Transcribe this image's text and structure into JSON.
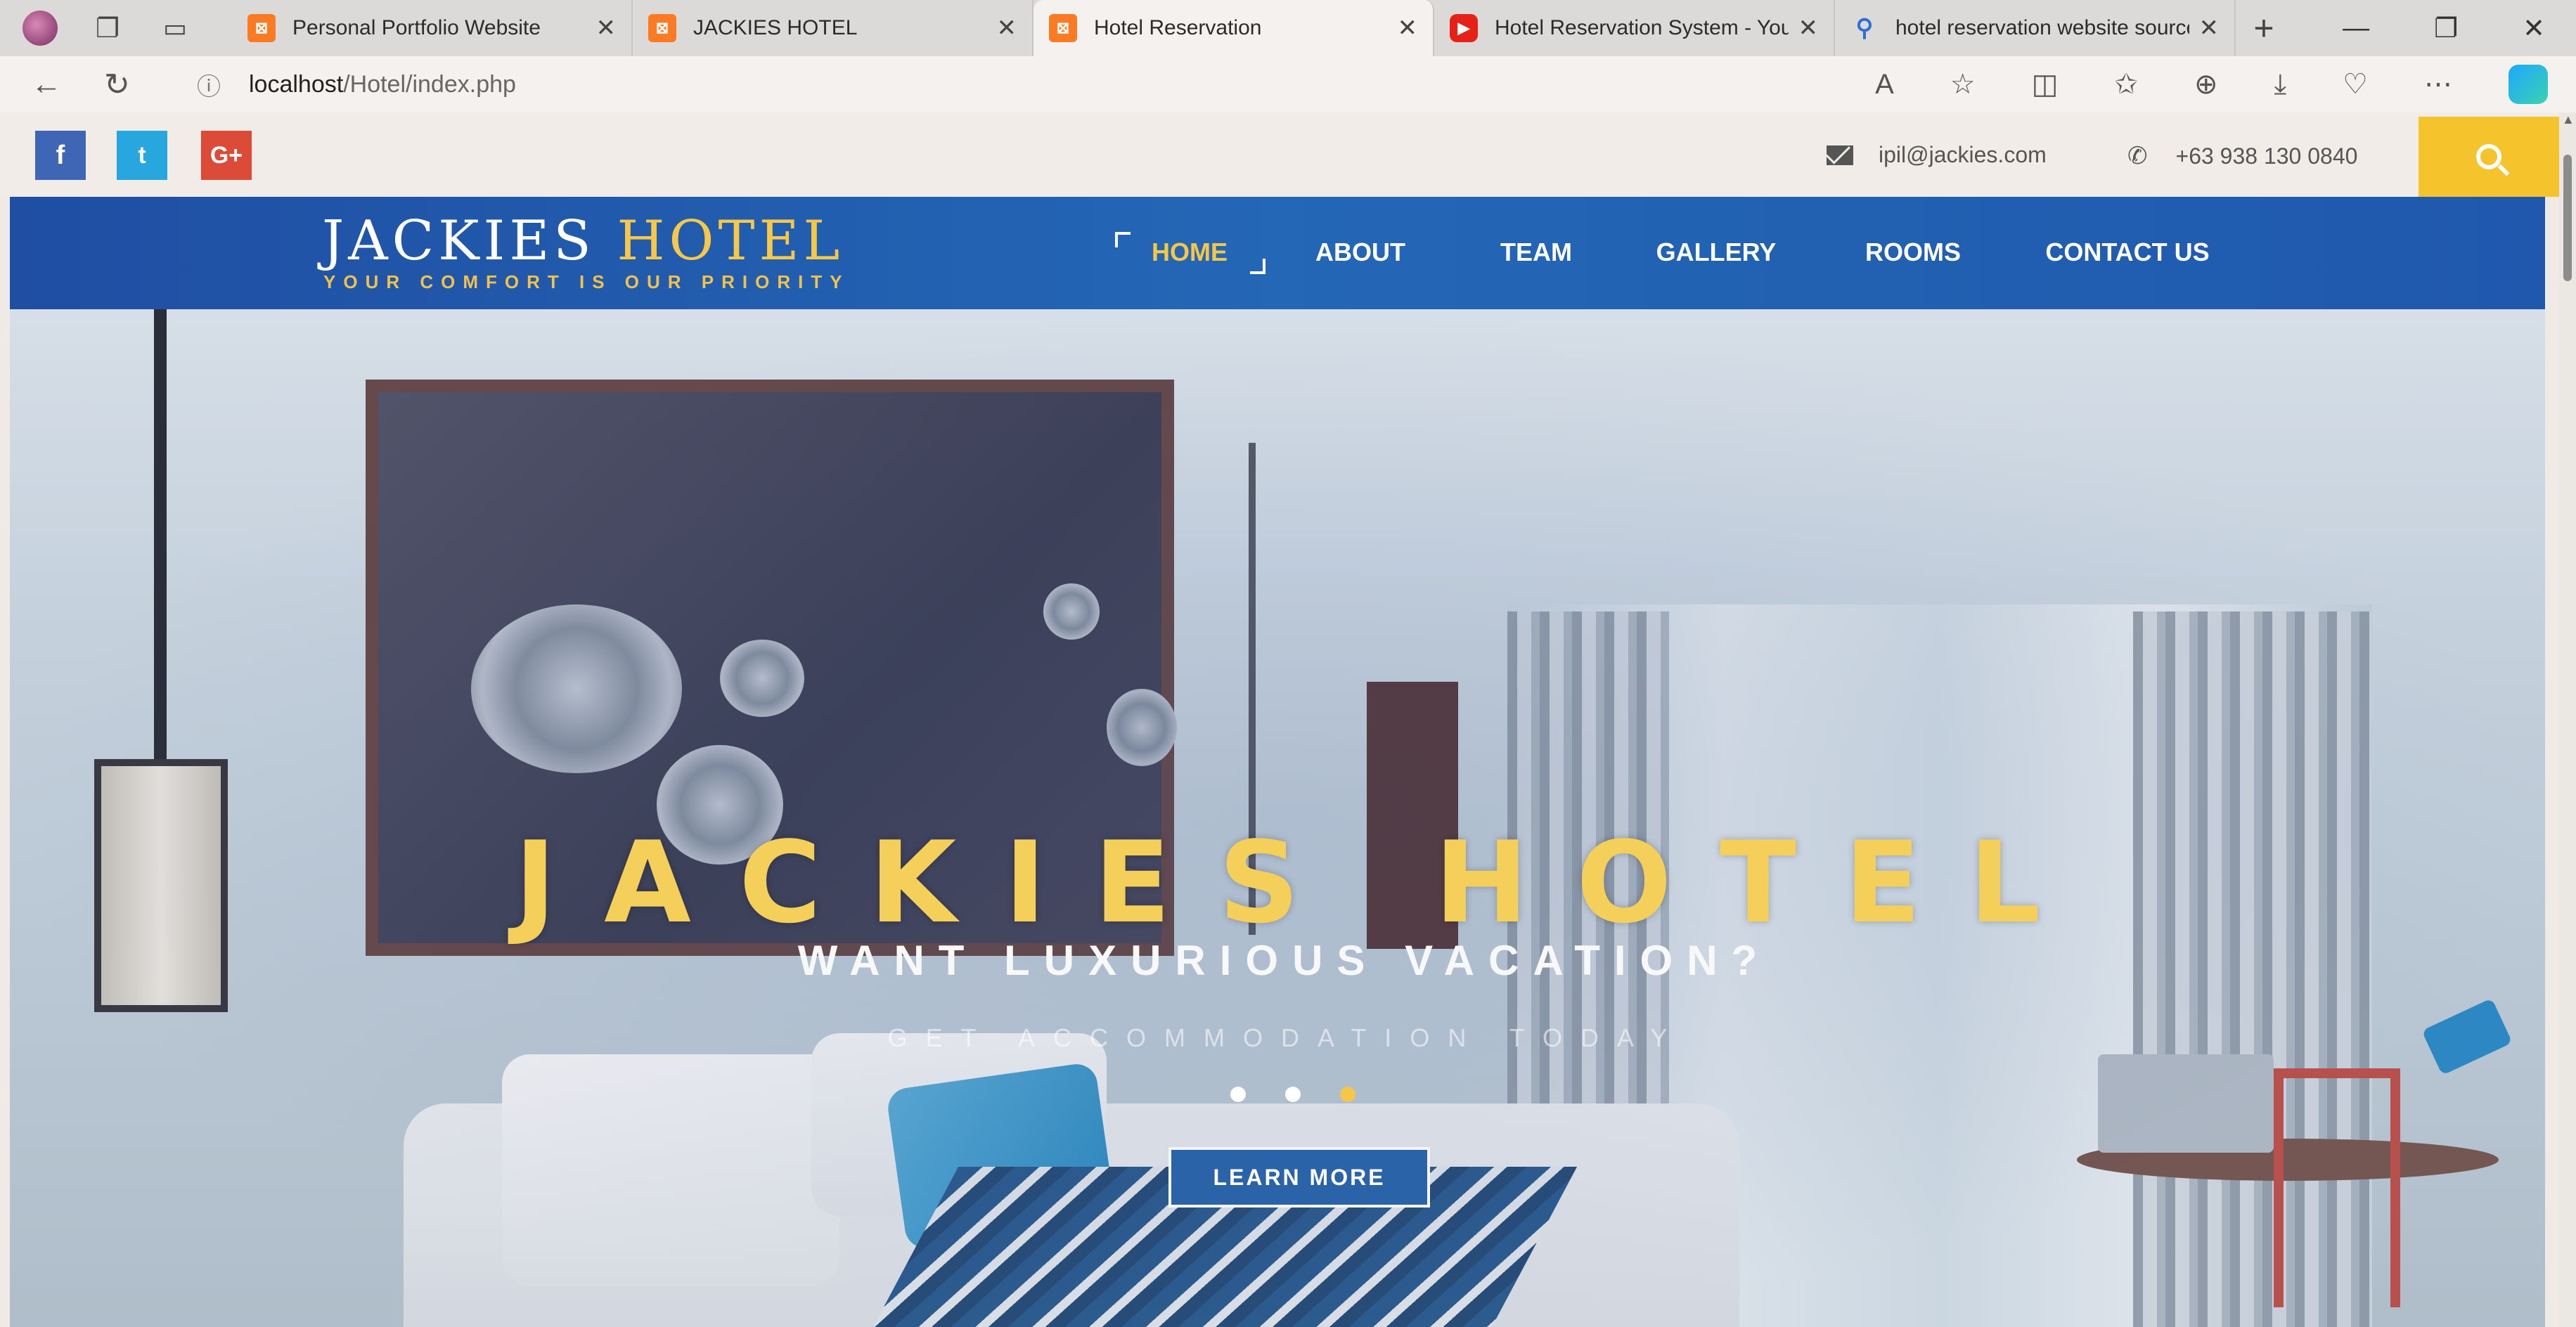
{
  "browser": {
    "tabs": [
      {
        "title": "Personal Portfolio Website",
        "favicon": "xampp-icon"
      },
      {
        "title": "JACKIES HOTEL",
        "favicon": "xampp-icon"
      },
      {
        "title": "Hotel Reservation",
        "favicon": "xampp-icon",
        "active": true
      },
      {
        "title": "Hotel Reservation System - YouT",
        "favicon": "youtube-icon"
      },
      {
        "title": "hotel reservation website source",
        "favicon": "search-icon"
      }
    ],
    "close_glyph": "✕",
    "new_tab_glyph": "+",
    "url_host": "localhost",
    "url_path": "/Hotel/index.php"
  },
  "site": {
    "social": {
      "facebook": "f",
      "twitter": "t",
      "googleplus": "G+"
    },
    "email": "ipil@jackies.com",
    "phone": "+63 938 130 0840",
    "logo": {
      "part1": "JACKIES",
      "part2": "HOTEL",
      "tagline": "YOUR COMFORT IS OUR PRIORITY"
    },
    "menu": {
      "home": "HOME",
      "about": "ABOUT",
      "team": "TEAM",
      "gallery": "GALLERY",
      "rooms": "ROOMS",
      "contact": "CONTACT US"
    },
    "hero": {
      "title": "JACKIES HOTEL",
      "subtitle": "WANT LUXURIOUS VACATION?",
      "tagline": "GET ACCOMMODATION TODAY",
      "button": "LEARN MORE",
      "slide_count": 3,
      "active_slide": 3
    },
    "colors": {
      "nav_blue": "#2467b6",
      "accent_yellow": "#f4c749",
      "search_yellow": "#f5c42c"
    }
  }
}
